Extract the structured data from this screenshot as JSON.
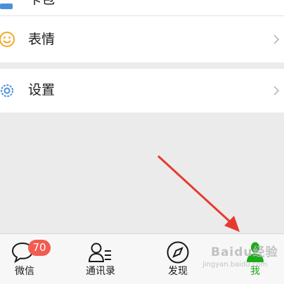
{
  "colors": {
    "background": "#ebebeb",
    "row_bg": "#ffffff",
    "accent_green": "#1aad19",
    "badge_red": "#f25b50",
    "arrow_red": "#e8392f"
  },
  "menu": {
    "partial_label": "卡包",
    "emoji_label": "表情",
    "settings_label": "设置"
  },
  "tabs": [
    {
      "label": "微信",
      "icon": "chat-bubble-icon"
    },
    {
      "label": "通讯录",
      "icon": "contacts-icon"
    },
    {
      "label": "发现",
      "icon": "compass-icon"
    },
    {
      "label": "我",
      "icon": "person-icon"
    }
  ],
  "badge": {
    "count": "70"
  },
  "watermark": {
    "text": "Baidu经验",
    "sub": "jingyan.baidu.com"
  }
}
